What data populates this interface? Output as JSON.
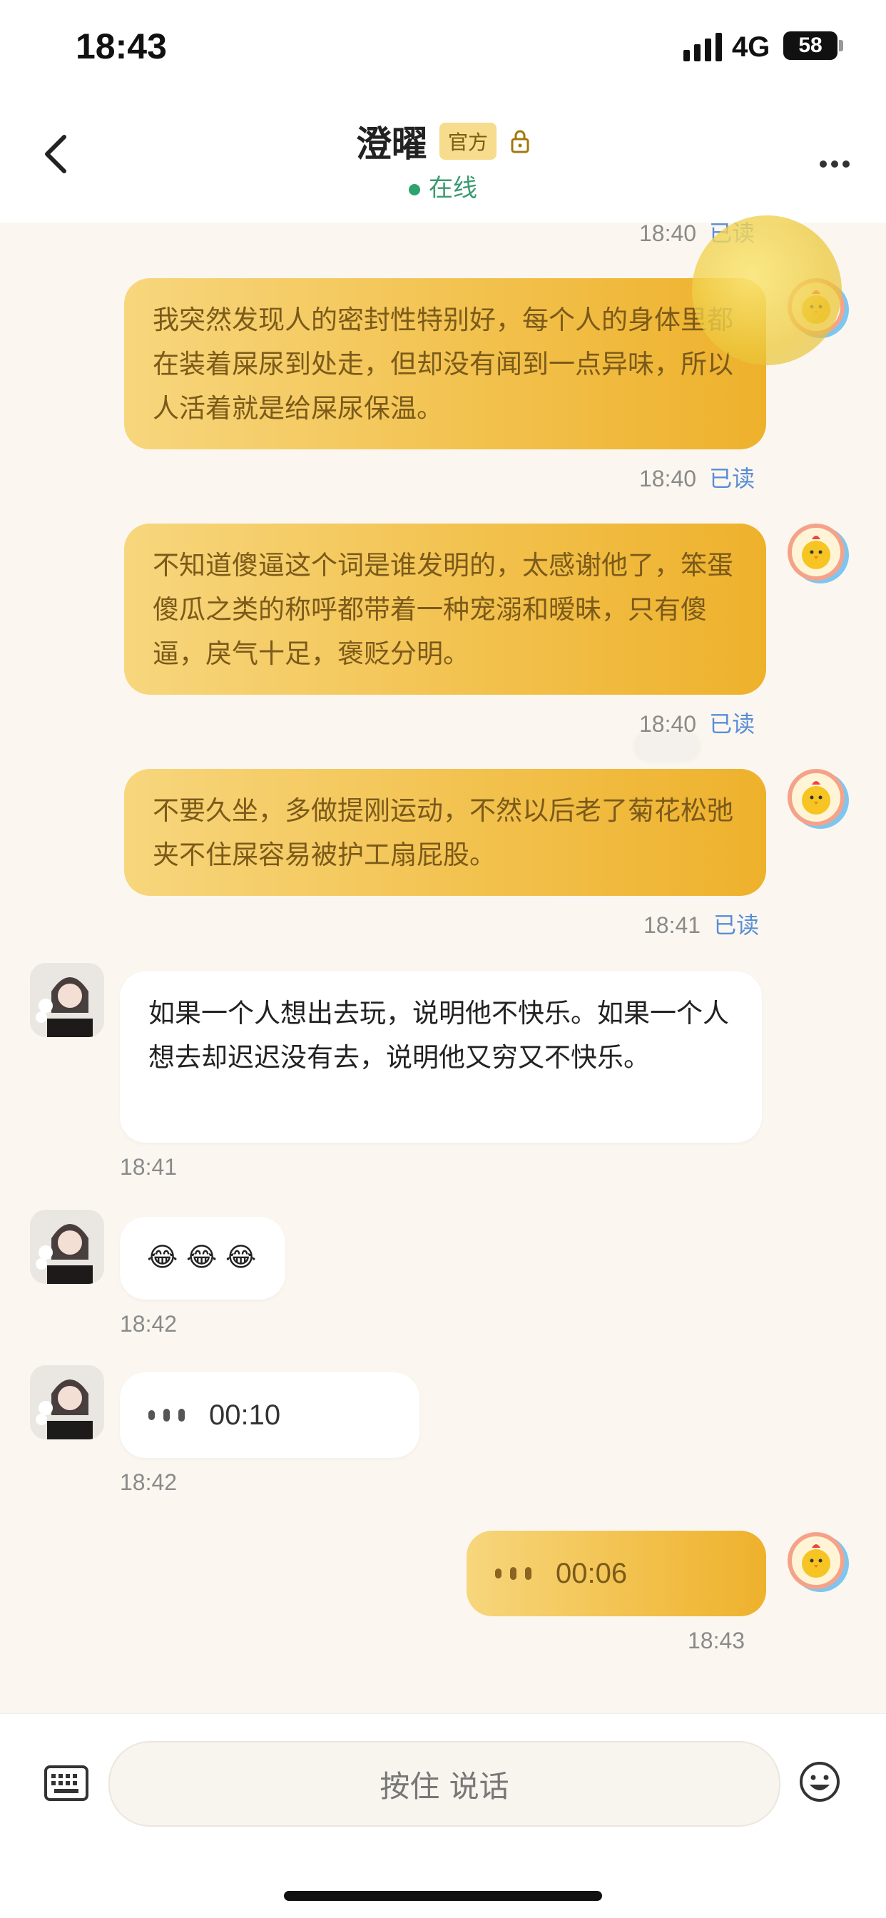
{
  "status_bar": {
    "time": "18:43",
    "network": "4G",
    "battery": "58"
  },
  "header": {
    "title": "澄曜",
    "badge": "官方",
    "online_status": "在线"
  },
  "messages": [
    {
      "id": 0,
      "direction": "out",
      "time": "18:40",
      "read": "已读",
      "partial_top": true
    },
    {
      "id": 1,
      "direction": "out",
      "text": "我突然发现人的密封性特别好，每个人的身体里都在装着屎尿到处走，但却没有闻到一点异味，所以人活着就是给屎尿保温。",
      "time": "18:40",
      "read": "已读"
    },
    {
      "id": 2,
      "direction": "out",
      "text": "不知道傻逼这个词是谁发明的，太感谢他了，笨蛋傻瓜之类的称呼都带着一种宠溺和暧昧，只有傻逼，戾气十足，褒贬分明。",
      "time": "18:40",
      "read": "已读"
    },
    {
      "id": 3,
      "direction": "out",
      "text": "不要久坐，多做提刚运动，不然以后老了菊花松弛夹不住屎容易被护工扇屁股。",
      "time": "18:41",
      "read": "已读"
    },
    {
      "id": 4,
      "direction": "in",
      "text": "如果一个人想出去玩，说明他不快乐。如果一个人想去却迟迟没有去，说明他又穷又不快乐。",
      "time": "18:41"
    },
    {
      "id": 5,
      "direction": "in",
      "text": "😂 😂 😂",
      "time": "18:42"
    },
    {
      "id": 6,
      "direction": "in",
      "voice_duration": "00:10",
      "time": "18:42"
    },
    {
      "id": 7,
      "direction": "out",
      "voice_duration": "00:06",
      "time": "18:43"
    }
  ],
  "input_bar": {
    "hold_to_talk": "按住 说话"
  },
  "colors": {
    "accent": "#f2c04a",
    "read": "#5a8dd6",
    "online": "#2fa36d"
  }
}
